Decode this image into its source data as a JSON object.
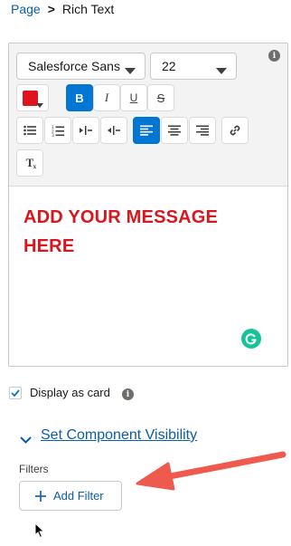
{
  "breadcrumb": {
    "parent": "Page",
    "separator": ">",
    "current": "Rich Text"
  },
  "toolbar": {
    "font_family": "Salesforce Sans",
    "font_size": "22",
    "text_color": "#e0141e",
    "accent": "#0176d3",
    "buttons": {
      "bold": "B",
      "italic": "I",
      "underline": "U",
      "strikethrough": "S",
      "clear_format": "T"
    }
  },
  "editor": {
    "message_line1": "ADD YOUR MESSAGE",
    "message_line2": "HERE",
    "message_color": "#d8161e"
  },
  "display_as_card": {
    "label": "Display as card",
    "checked": true
  },
  "visibility": {
    "link": "Set Component Visibility",
    "filters_label": "Filters",
    "add_filter": "Add Filter"
  },
  "icons": {
    "info": "info-icon",
    "grammarly": "grammarly-icon",
    "chevron": "chevron-down-icon",
    "plus": "plus-icon",
    "arrow": "annotation-arrow",
    "cursor": "mouse-pointer-icon"
  }
}
